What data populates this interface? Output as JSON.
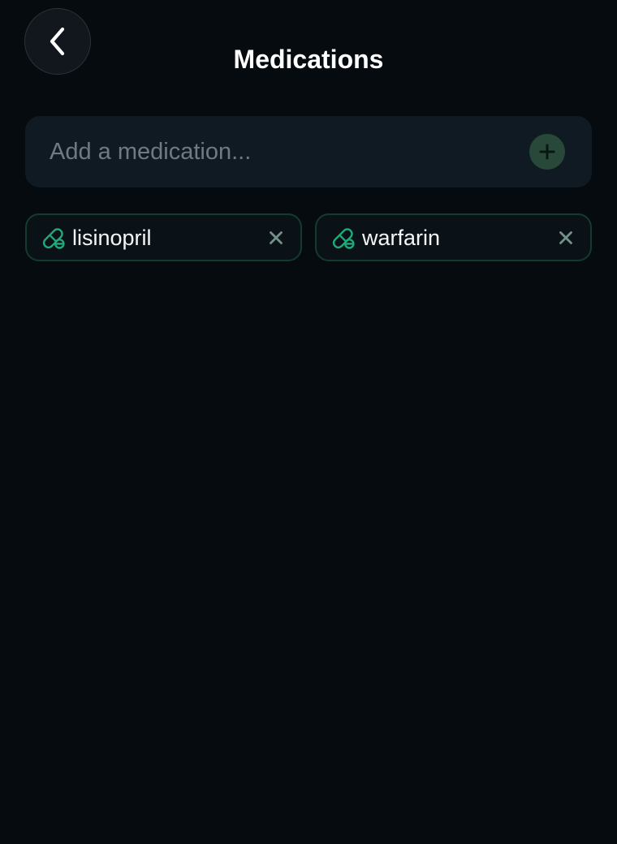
{
  "header": {
    "back_icon": "chevron-left-icon",
    "title": "Medications"
  },
  "medication_form": {
    "placeholder": "Add a medication...",
    "value": "",
    "add_icon": "plus-icon"
  },
  "medications": [
    {
      "name": "lisinopril",
      "icon": "pill-icon",
      "remove_icon": "close-icon"
    },
    {
      "name": "warfarin",
      "icon": "pill-icon",
      "remove_icon": "close-icon"
    }
  ],
  "colors": {
    "background": "#060b10",
    "surface": "#101a22",
    "accent": "#20a979",
    "accent_dark": "#28483a",
    "chip_border": "#143b2e",
    "muted_text": "#6f7a82",
    "primary_text": "#f3f6f8"
  }
}
